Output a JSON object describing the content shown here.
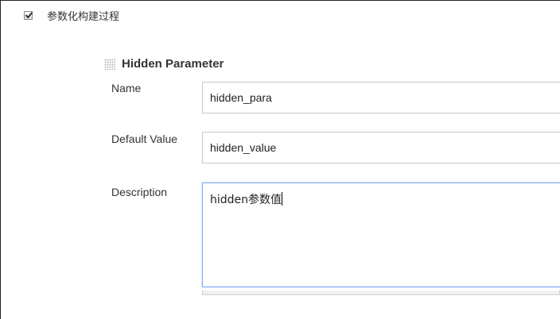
{
  "checkbox": {
    "label": "参数化构建过程",
    "checked": true
  },
  "parameter": {
    "title": "Hidden Parameter",
    "fields": {
      "name": {
        "label": "Name",
        "value": "hidden_para"
      },
      "default_value": {
        "label": "Default Value",
        "value": "hidden_value"
      },
      "description": {
        "label": "Description",
        "value": "hidden参数值"
      }
    }
  }
}
